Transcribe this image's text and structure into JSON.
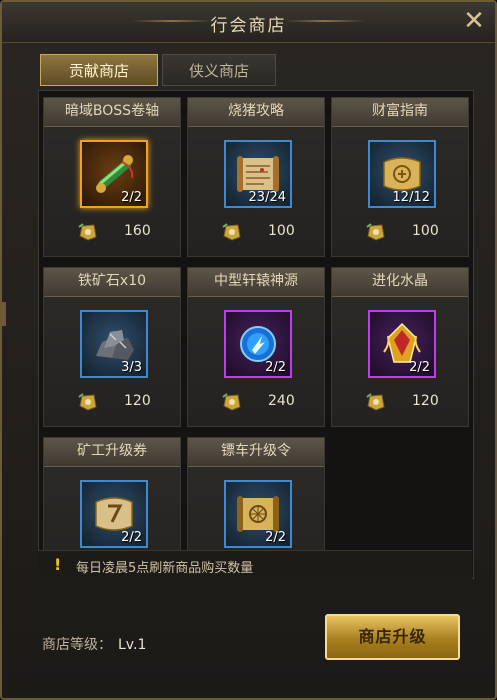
{
  "window": {
    "title": "行会商店",
    "close_icon": "close-icon"
  },
  "tabs": [
    {
      "label": "贡献商店",
      "active": true
    },
    {
      "label": "侠义商店",
      "active": false
    }
  ],
  "items": [
    {
      "name": "暗域BOSS卷轴",
      "icon": "green-scroll-icon",
      "count": "2/2",
      "price": "160",
      "rarity": "gold"
    },
    {
      "name": "烧猪攻略",
      "icon": "map-scroll-icon",
      "count": "23/24",
      "price": "100",
      "rarity": "blue"
    },
    {
      "name": "财富指南",
      "icon": "gold-scroll-icon",
      "count": "12/12",
      "price": "100",
      "rarity": "blue"
    },
    {
      "name": "铁矿石x10",
      "icon": "iron-ore-icon",
      "count": "3/3",
      "price": "120",
      "rarity": "blue"
    },
    {
      "name": "中型轩辕神源",
      "icon": "blue-orb-icon",
      "count": "2/2",
      "price": "240",
      "rarity": "purple"
    },
    {
      "name": "进化水晶",
      "icon": "evolution-crystal-icon",
      "count": "2/2",
      "price": "120",
      "rarity": "purple"
    },
    {
      "name": "矿工升级券",
      "icon": "miner-scroll-icon",
      "count": "2/2",
      "price": "",
      "rarity": "blue"
    },
    {
      "name": "镖车升级令",
      "icon": "cart-scroll-icon",
      "count": "2/2",
      "price": "",
      "rarity": "blue"
    }
  ],
  "notice": {
    "text": "每日凌晨5点刷新商品购买数量"
  },
  "footer": {
    "level_label": "商店等级：",
    "level_value": "Lv.1",
    "upgrade_label": "商店升级"
  },
  "colors": {
    "gold_border": "#f2a020",
    "blue_border": "#3c8ad0",
    "purple_border": "#c13cf0",
    "button_gold": "#d4ac3f"
  }
}
